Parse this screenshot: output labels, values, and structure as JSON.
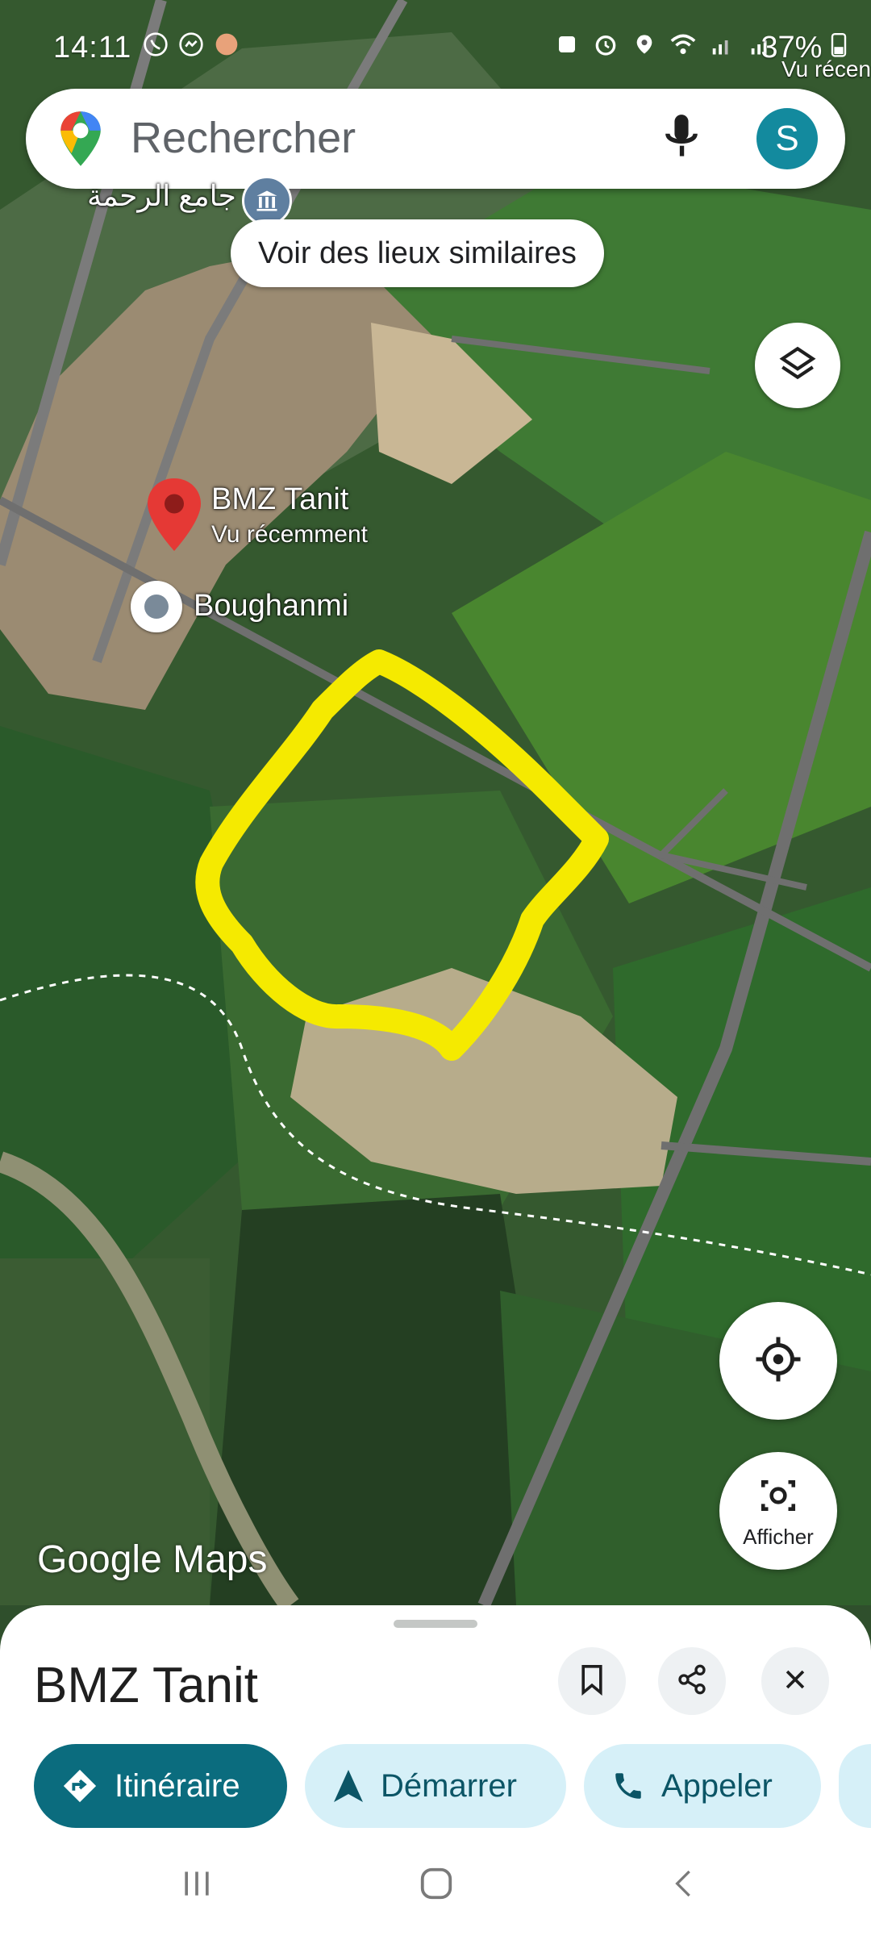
{
  "status_bar": {
    "time": "14:11",
    "battery": "37%",
    "overflow_text": "Vu récen",
    "left_icons": [
      "whatsapp-icon",
      "messenger-icon",
      "app-icon"
    ],
    "right_icons": [
      "screenshot-icon",
      "alarm-icon",
      "location-icon",
      "wifi-icon",
      "signal-icon",
      "signal-icon"
    ]
  },
  "search": {
    "placeholder": "Rechercher",
    "avatar_initial": "S"
  },
  "map": {
    "chip_label": "Voir des lieux similaires",
    "arabic_label": "جامع الرحمة",
    "marker": {
      "name": "BMZ Tanit",
      "subtitle": "Vu récemment"
    },
    "current_place": "Boughanmi",
    "watermark": "Google Maps",
    "lens_label": "Afficher",
    "highlight_color": "#f5ea00"
  },
  "sheet": {
    "title": "BMZ Tanit",
    "actions": [
      {
        "label": "Itinéraire",
        "icon": "directions-icon"
      },
      {
        "label": "Démarrer",
        "icon": "navigation-icon"
      },
      {
        "label": "Appeler",
        "icon": "phone-icon"
      }
    ]
  },
  "colors": {
    "primary": "#0b6c7e",
    "secondary_bg": "#d6f0f8",
    "avatar": "#138a9e",
    "marker": "#e53935"
  }
}
